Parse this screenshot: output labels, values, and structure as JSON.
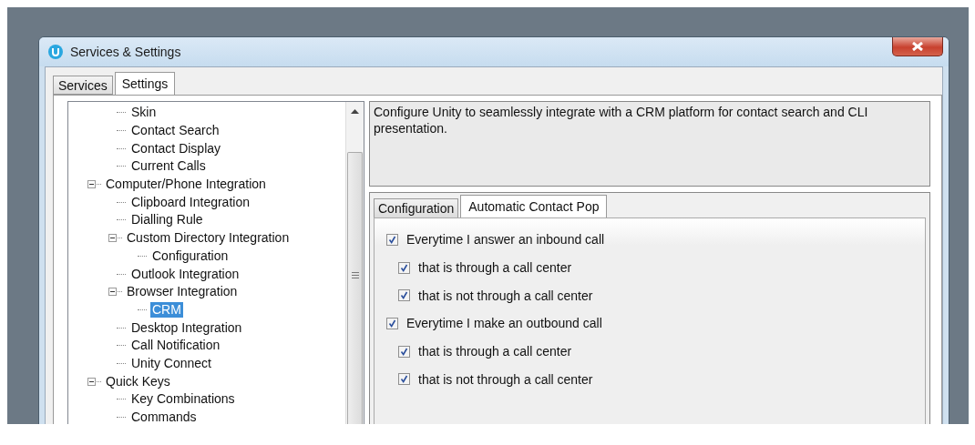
{
  "window": {
    "title": "Services & Settings"
  },
  "tabs": [
    {
      "label": "Services",
      "selected": false
    },
    {
      "label": "Settings",
      "selected": true
    }
  ],
  "tree": {
    "items": [
      {
        "children": [
          {
            "label": "Skin",
            "selected": false
          },
          {
            "label": "Contact Search",
            "selected": false
          },
          {
            "label": "Contact Display",
            "selected": false
          },
          {
            "label": "Current Calls",
            "selected": false
          }
        ]
      },
      {
        "label": "Computer/Phone Integration",
        "selected": false,
        "expanded": true,
        "children": [
          {
            "label": "Clipboard Integration",
            "selected": false
          },
          {
            "label": "Dialling Rule",
            "selected": false
          },
          {
            "label": "Custom Directory Integration",
            "selected": false,
            "expanded": true,
            "children": [
              {
                "label": "Configuration",
                "selected": false
              }
            ]
          },
          {
            "label": "Outlook Integration",
            "selected": false
          },
          {
            "label": "Browser Integration",
            "selected": false,
            "expanded": true,
            "children": [
              {
                "label": "CRM",
                "selected": true
              }
            ]
          },
          {
            "label": "Desktop Integration",
            "selected": false
          },
          {
            "label": "Call Notification",
            "selected": false
          },
          {
            "label": "Unity Connect",
            "selected": false
          }
        ]
      },
      {
        "label": "Quick Keys",
        "selected": false,
        "expanded": true,
        "children": [
          {
            "label": "Key Combinations",
            "selected": false
          },
          {
            "label": "Commands",
            "selected": false
          }
        ]
      }
    ]
  },
  "description": "Configure Unity to seamlessly integrate with a CRM platform for contact search and CLI presentation.",
  "panel_tabs": [
    {
      "label": "Configuration",
      "selected": false
    },
    {
      "label": "Automatic Contact Pop",
      "selected": true
    }
  ],
  "options": [
    {
      "label": "Everytime I answer an inbound call",
      "checked": true,
      "children": [
        {
          "label": "that is through a call center",
          "checked": true
        },
        {
          "label": "that is not through a call center",
          "checked": true
        }
      ]
    },
    {
      "label": "Everytime I make an outbound call",
      "checked": true,
      "children": [
        {
          "label": "that is through a call center",
          "checked": true
        },
        {
          "label": "that is not through a call center",
          "checked": true
        }
      ]
    }
  ]
}
